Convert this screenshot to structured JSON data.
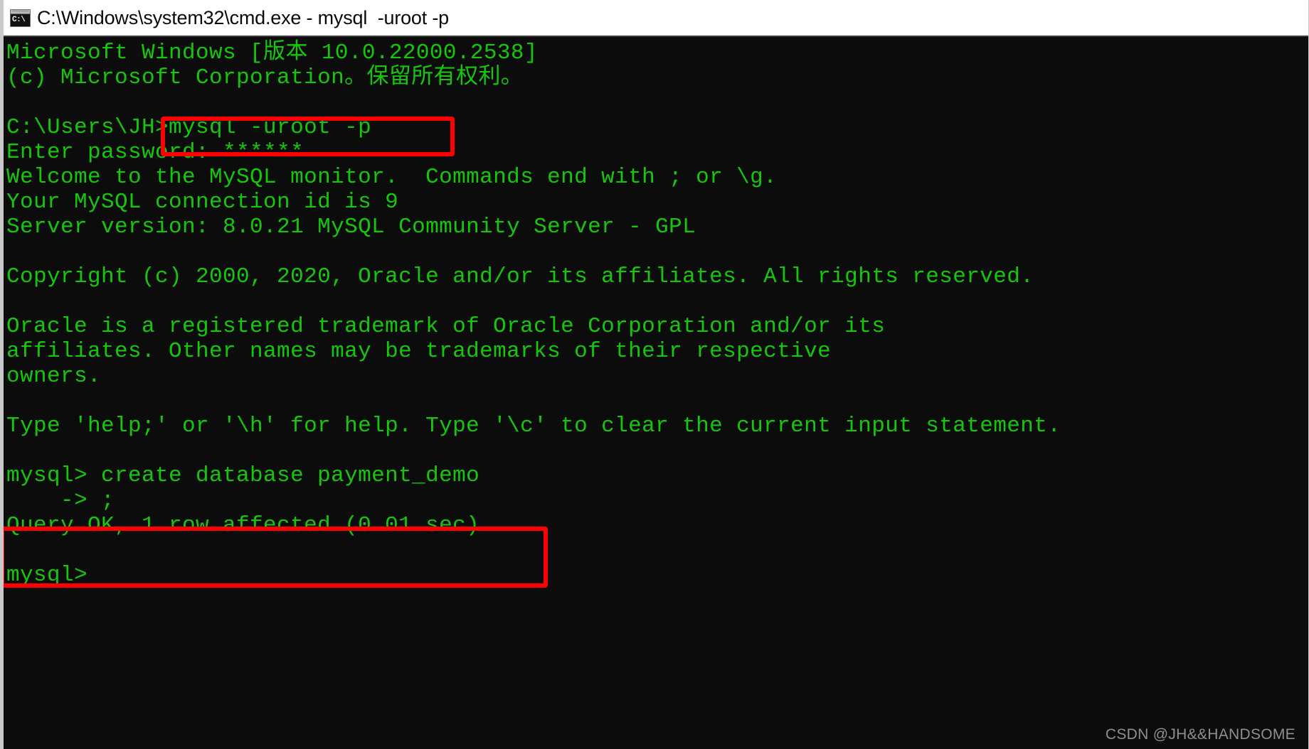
{
  "window": {
    "title": "C:\\Windows\\system32\\cmd.exe - mysql  -uroot -p",
    "icon": "cmd-console-icon",
    "icon_text": "C:\\",
    "background_color": "#0c0c0c",
    "text_color": "#16c60c",
    "titlebar_color": "#ffffff"
  },
  "console": {
    "lines": [
      "Microsoft Windows [版本 10.0.22000.2538]",
      "(c) Microsoft Corporation。保留所有权利。",
      "",
      "C:\\Users\\JH>mysql -uroot -p",
      "Enter password: ******",
      "Welcome to the MySQL monitor.  Commands end with ; or \\g.",
      "Your MySQL connection id is 9",
      "Server version: 8.0.21 MySQL Community Server - GPL",
      "",
      "Copyright (c) 2000, 2020, Oracle and/or its affiliates. All rights reserved.",
      "",
      "Oracle is a registered trademark of Oracle Corporation and/or its",
      "affiliates. Other names may be trademarks of their respective",
      "owners.",
      "",
      "Type 'help;' or '\\h' for help. Type '\\c' to clear the current input statement.",
      "",
      "mysql> create database payment_demo",
      "    -> ;",
      "Query OK, 1 row affected (0.01 sec)",
      "",
      "mysql>"
    ]
  },
  "annotations": {
    "color": "#ff0000",
    "boxes": [
      {
        "name": "mysql-login-command-highlight",
        "target_text": "mysql -uroot -p"
      },
      {
        "name": "create-database-command-highlight",
        "target_text": "mysql> create database payment_demo    -> ;"
      }
    ]
  },
  "watermark": {
    "text": "CSDN @JH&&HANDSOME"
  }
}
